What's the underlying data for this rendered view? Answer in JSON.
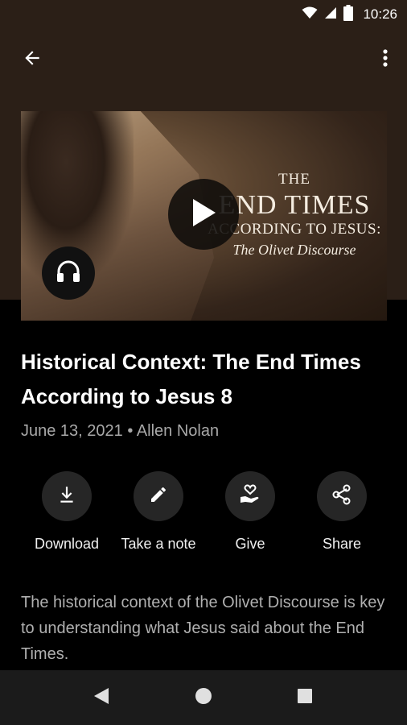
{
  "status_bar": {
    "time": "10:26",
    "icons": [
      "wifi-icon",
      "signal-icon",
      "battery-icon"
    ]
  },
  "app_bar": {
    "back_icon": "arrow-left-icon",
    "more_icon": "more-vertical-icon"
  },
  "artwork": {
    "line1": "THE",
    "line2": "END TIMES",
    "line3": "ACCORDING TO JESUS:",
    "line4": "The Olivet Discourse",
    "play_icon": "play-icon",
    "audio_icon": "headphones-icon"
  },
  "episode": {
    "title": "Historical Context: The End Times According to Jesus 8",
    "date": "June 13, 2021",
    "separator": "•",
    "speaker": "Allen Nolan",
    "description": "The historical context of the Olivet Discourse is key to understanding what Jesus said about the End Times."
  },
  "actions": [
    {
      "label": "Download",
      "icon": "download-icon"
    },
    {
      "label": "Take a note",
      "icon": "pencil-icon"
    },
    {
      "label": "Give",
      "icon": "give-heart-hand-icon"
    },
    {
      "label": "Share",
      "icon": "share-icon"
    }
  ],
  "nav_bar": {
    "icons": [
      "nav-back-icon",
      "nav-home-icon",
      "nav-recents-icon"
    ]
  },
  "colors": {
    "header_bg": "#2b1f17",
    "page_bg": "#000000",
    "action_circle": "#262626",
    "nav_bg": "#1b1b1b"
  }
}
